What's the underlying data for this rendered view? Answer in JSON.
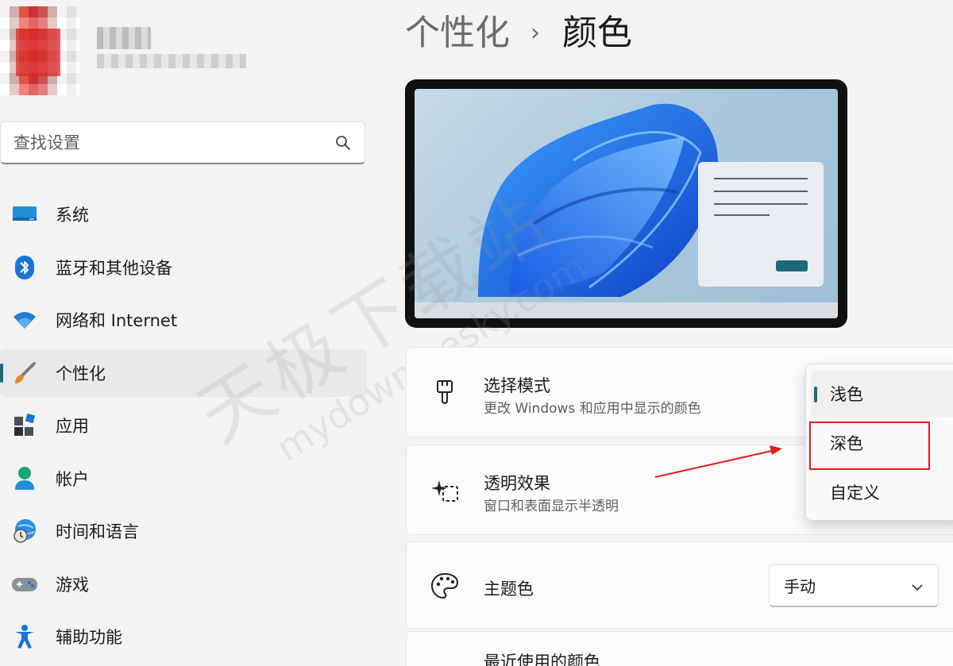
{
  "profile": {
    "avatar": "blurred-avatar",
    "name": "",
    "email": ""
  },
  "search": {
    "placeholder": "查找设置",
    "icon": "search-icon"
  },
  "nav": {
    "items": [
      {
        "label": "系统",
        "icon": "system-icon"
      },
      {
        "label": "蓝牙和其他设备",
        "icon": "bluetooth-icon"
      },
      {
        "label": "网络和 Internet",
        "icon": "wifi-icon"
      },
      {
        "label": "个性化",
        "icon": "paint-brush-icon",
        "active": true
      },
      {
        "label": "应用",
        "icon": "apps-icon"
      },
      {
        "label": "帐户",
        "icon": "account-icon"
      },
      {
        "label": "时间和语言",
        "icon": "time-language-icon"
      },
      {
        "label": "游戏",
        "icon": "gamepad-icon"
      },
      {
        "label": "辅助功能",
        "icon": "accessibility-icon"
      }
    ]
  },
  "header": {
    "parent": "个性化",
    "separator": "›",
    "current": "颜色"
  },
  "settings": {
    "mode": {
      "title": "选择模式",
      "desc": "更改 Windows 和应用中显示的颜色",
      "icon": "brush-icon"
    },
    "transparency": {
      "title": "透明效果",
      "desc": "窗口和表面显示半透明",
      "icon": "sparkle-icon"
    },
    "accent": {
      "title": "主题色",
      "icon": "palette-icon",
      "value": "手动"
    },
    "recent": {
      "title": "最近使用的颜色"
    }
  },
  "mode_dropdown": {
    "options": [
      "浅色",
      "深色",
      "自定义"
    ],
    "selected": "浅色",
    "highlighted": "深色"
  },
  "watermark": {
    "cn": "天极下载站",
    "en": "mydown.yesky.com"
  },
  "colors": {
    "accent": "#1b6a7a",
    "highlight_box": "#e21b1b",
    "arrow": "#e21b1b"
  }
}
